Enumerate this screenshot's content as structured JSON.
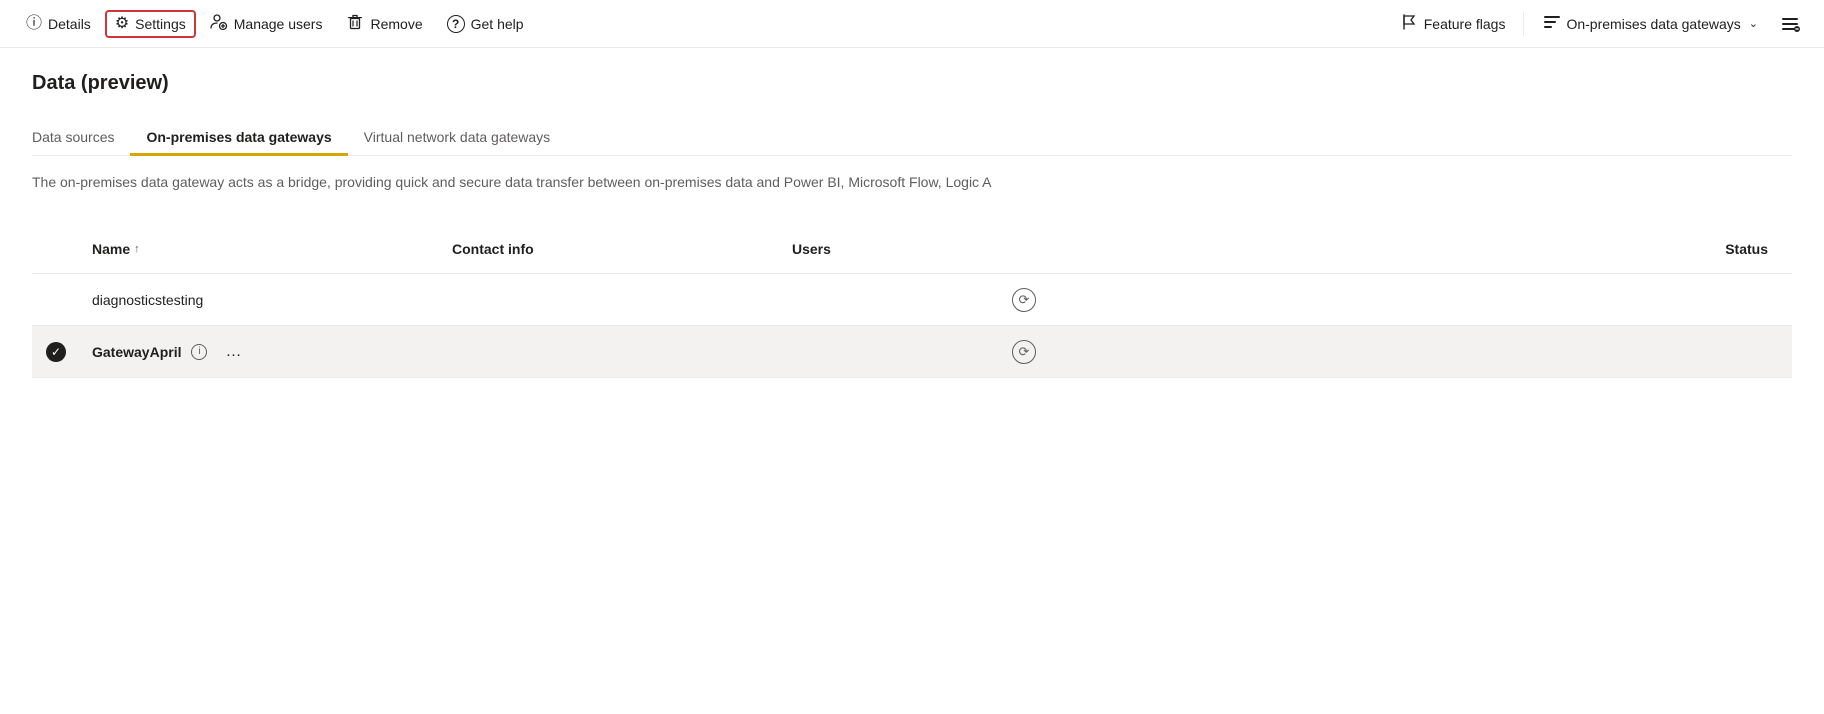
{
  "toolbar": {
    "left": [
      {
        "id": "details",
        "icon": "ⓘ",
        "label": "Details",
        "highlighted": false
      },
      {
        "id": "settings",
        "icon": "⚙",
        "label": "Settings",
        "highlighted": true
      },
      {
        "id": "manage-users",
        "icon": "👥",
        "label": "Manage users",
        "highlighted": false
      },
      {
        "id": "remove",
        "icon": "🗑",
        "label": "Remove",
        "highlighted": false
      },
      {
        "id": "get-help",
        "icon": "?",
        "label": "Get help",
        "highlighted": false
      }
    ],
    "right": [
      {
        "id": "feature-flags",
        "icon": "⚑",
        "label": "Feature flags"
      },
      {
        "id": "on-premises-gateways",
        "icon": "≡",
        "label": "On-premises data gateways",
        "hasDropdown": true
      }
    ]
  },
  "page": {
    "title": "Data (preview)"
  },
  "tabs": [
    {
      "id": "data-sources",
      "label": "Data sources",
      "active": false
    },
    {
      "id": "on-premises",
      "label": "On-premises data gateways",
      "active": true
    },
    {
      "id": "virtual-network",
      "label": "Virtual network data gateways",
      "active": false
    }
  ],
  "description": "The on-premises data gateway acts as a bridge, providing quick and secure data transfer between on-premises data and Power BI, Microsoft Flow, Logic A",
  "table": {
    "columns": [
      {
        "id": "check",
        "label": ""
      },
      {
        "id": "name",
        "label": "Name",
        "sortIcon": "↑"
      },
      {
        "id": "contact",
        "label": "Contact info"
      },
      {
        "id": "users",
        "label": "Users"
      },
      {
        "id": "status",
        "label": "Status"
      }
    ],
    "rows": [
      {
        "id": "row1",
        "selected": false,
        "name": "diagnosticstesting",
        "contactInfo": "",
        "users": "",
        "status": "⟳"
      },
      {
        "id": "row2",
        "selected": true,
        "name": "GatewayApril",
        "contactInfo": "",
        "users": "",
        "status": "⟳"
      }
    ]
  }
}
